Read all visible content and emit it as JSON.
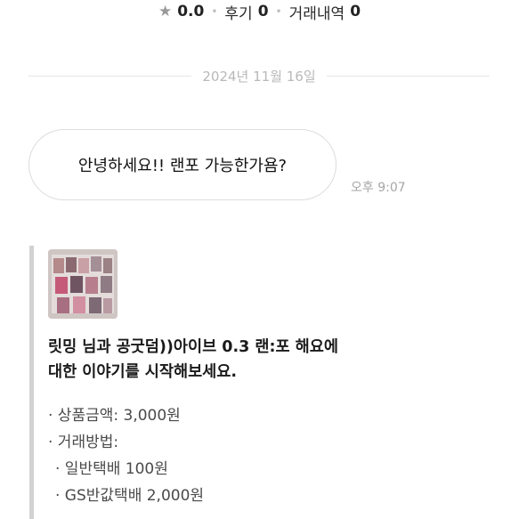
{
  "header": {
    "rating_icon": "star-icon",
    "rating": "0.0",
    "reviews_label": "후기",
    "reviews_count": "0",
    "trades_label": "거래내역",
    "trades_count": "0"
  },
  "chat": {
    "date_divider": "2024년 11월 16일",
    "messages": [
      {
        "text": "안녕하세요!! 랜포 가능한가욤?",
        "time": "오후 9:07"
      }
    ]
  },
  "product_card": {
    "title_line1": "릿밍 님과 공굿덤))아이브 0.3 랜:포 해요에",
    "title_line2": "대한 이야기를 시작해보세요.",
    "price": "· 상품금액: 3,000원",
    "shipping_label": "· 거래방법:",
    "shipping_options": [
      "· 일반택배 100원",
      "· GS반값택배 2,000원"
    ]
  },
  "colors": {
    "border_accent": "#d2d2d2",
    "muted_text": "#b8b8b8",
    "bubble_border": "#dcdcdc"
  }
}
